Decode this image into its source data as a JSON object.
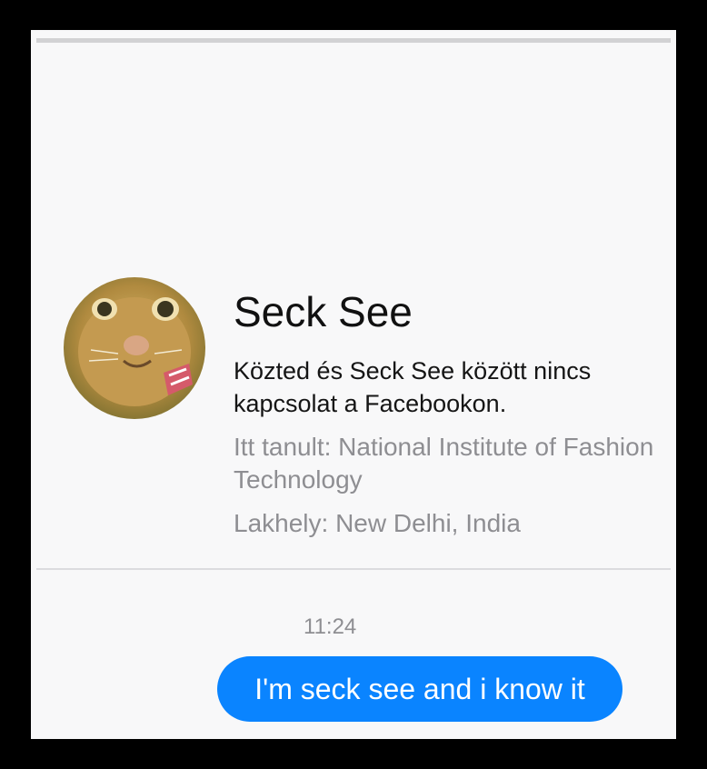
{
  "profile": {
    "name": "Seck See",
    "avatar_icon": "cat-profile-photo",
    "connection_text": "Közted és Seck See között nincs kapcsolat a Facebookon.",
    "education": "Itt tanult: National Institute of Fashion Technology",
    "location": "Lakhely: New Delhi, India"
  },
  "conversation": {
    "timestamp": "11:24",
    "messages": [
      {
        "text": "I'm seck see and i know it",
        "direction": "outgoing",
        "bubble_color": "#0a84ff"
      }
    ]
  },
  "colors": {
    "background": "#f8f8f9",
    "accent": "#0a84ff",
    "secondary_text": "#8e8e92"
  }
}
